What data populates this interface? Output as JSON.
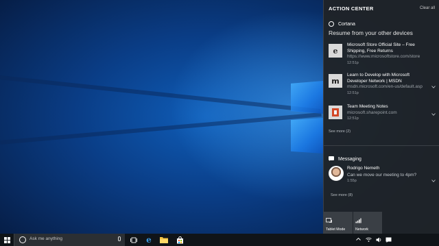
{
  "action_center": {
    "title": "ACTION CENTER",
    "clear_all": "Clear all",
    "cortana": {
      "label": "Cortana",
      "subheading": "Resume from your other devices",
      "items": [
        {
          "title": "Microsoft Store Official Site – Free Shipping, Free Returns",
          "url": "https://www.microsoftstore.com/store",
          "time": "12:51p",
          "icon": "edge-icon"
        },
        {
          "title": "Learn to Develop with Microsoft Developer Network | MSDN",
          "url": "msdn.microsoft.com/en-us/default.asp",
          "time": "12:51p",
          "icon": "msdn-icon"
        },
        {
          "title": "Team Meeting Notes",
          "url": "microsoft.sharepoint.com",
          "time": "12:51p",
          "icon": "sharepoint-icon"
        }
      ],
      "see_more": "See more (2)"
    },
    "messaging": {
      "label": "Messaging",
      "message": {
        "name": "Rodrigo Nemeth",
        "body": "Can we move our meeting to 4pm?",
        "time": "1:55p"
      },
      "see_more": "See more (8)"
    },
    "quick_actions": [
      {
        "label": "Tablet Mode",
        "icon": "tablet-mode-icon"
      },
      {
        "label": "Network",
        "icon": "network-icon"
      }
    ]
  },
  "taskbar": {
    "search_placeholder": "Ask me anything",
    "icons": [
      "windows-start-icon",
      "task-view-icon",
      "edge-icon",
      "file-explorer-icon",
      "store-icon"
    ],
    "tray_icons": [
      "chevron-up-icon",
      "network-icon",
      "volume-icon",
      "notifications-icon"
    ]
  },
  "colors": {
    "action_center_bg": "#1f2328",
    "taskbar_bg": "#101418",
    "accent": "#6fb4ff",
    "desktop_blue": "#0f5db8"
  }
}
